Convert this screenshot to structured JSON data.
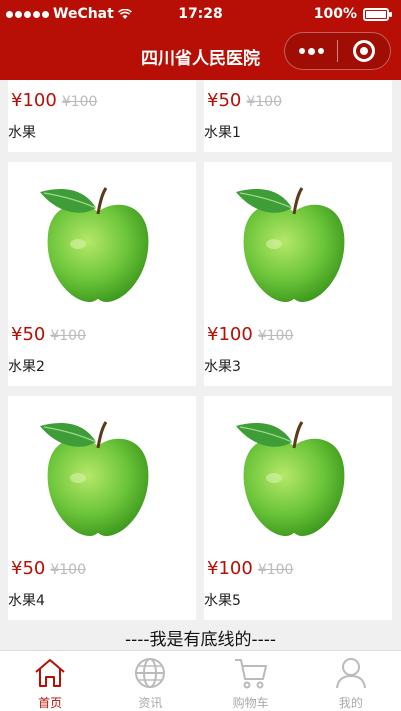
{
  "status_bar": {
    "carrier": "WeChat",
    "time": "17:28",
    "battery": "100%"
  },
  "nav": {
    "title": "四川省人民医院"
  },
  "products": [
    {
      "price": "¥100",
      "old_price": "¥100",
      "name": "水果"
    },
    {
      "price": "¥50",
      "old_price": "¥100",
      "name": "水果1"
    },
    {
      "price": "¥50",
      "old_price": "¥100",
      "name": "水果2"
    },
    {
      "price": "¥100",
      "old_price": "¥100",
      "name": "水果3"
    },
    {
      "price": "¥50",
      "old_price": "¥100",
      "name": "水果4"
    },
    {
      "price": "¥100",
      "old_price": "¥100",
      "name": "水果5"
    }
  ],
  "footer_text": "----我是有底线的----",
  "tabs": [
    {
      "label": "首页",
      "icon": "home-icon",
      "active": true
    },
    {
      "label": "资讯",
      "icon": "globe-icon",
      "active": false
    },
    {
      "label": "购物车",
      "icon": "cart-icon",
      "active": false
    },
    {
      "label": "我的",
      "icon": "user-icon",
      "active": false
    }
  ],
  "colors": {
    "brand": "#b70f05",
    "price": "#b70f05",
    "old_price": "#bbbbbb",
    "inactive_tab": "#aaaaaa"
  }
}
